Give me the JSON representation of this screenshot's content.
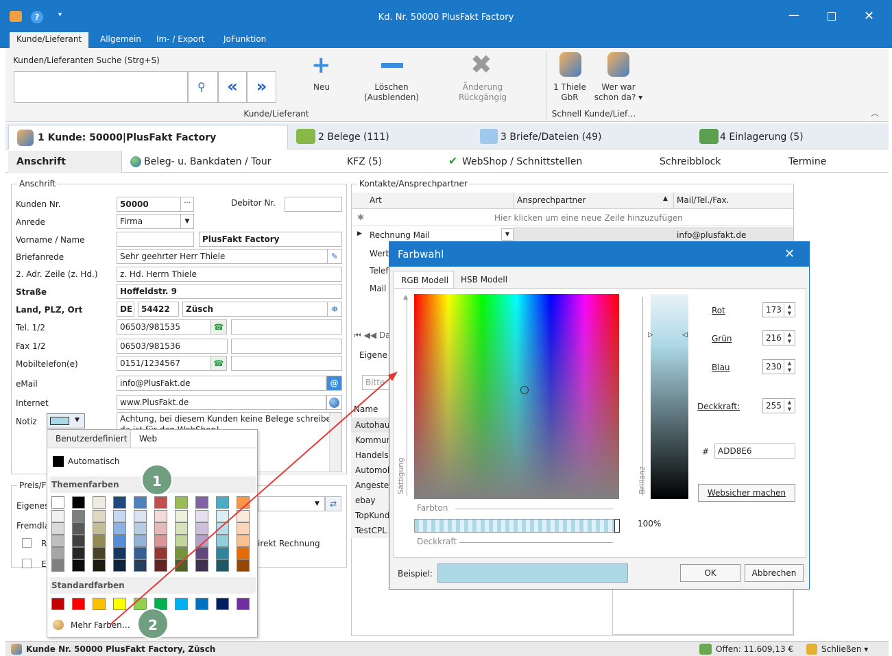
{
  "window": {
    "title": "Kd. Nr. 50000 PlusFakt Factory"
  },
  "menu": {
    "items": [
      "Kunde/Lieferant",
      "Allgemein",
      "Im- / Export",
      "JoFunktion"
    ]
  },
  "ribbon": {
    "search_label": "Kunden/Lieferanten Suche (Strg+S)",
    "search_value": "",
    "neu": "Neu",
    "loeschen_1": "Löschen",
    "loeschen_2": "(Ausblenden)",
    "rueck": "Änderung Rückgängig",
    "thiele_1": "1 Thiele",
    "thiele_2": "GbR",
    "werwar_1": "Wer war",
    "werwar_2": "schon da? ▾",
    "group1": "Kunde/Lieferant",
    "group2": "Schnell Kunde/Lief…"
  },
  "tabs_main": [
    "1 Kunde: 50000|PlusFakt Factory",
    "2 Belege (111)",
    "3 Briefe/Dateien (49)",
    "4 Einlagerung (5)"
  ],
  "tabs_sub": [
    "Anschrift",
    "Beleg- u. Bankdaten / Tour",
    "KFZ (5)",
    "WebShop / Schnittstellen",
    "Schreibblock",
    "Termine"
  ],
  "anschrift": {
    "group": "Anschrift",
    "kunden_nr_label": "Kunden Nr.",
    "kunden_nr": "50000",
    "debitor_label": "Debitor Nr.",
    "debitor": "",
    "anrede_label": "Anrede",
    "anrede": "Firma",
    "name_label": "Vorname / Name",
    "vorname": "",
    "name": "PlusFakt Factory",
    "briefanrede_label": "Briefanrede",
    "briefanrede": "Sehr geehrter Herr Thiele",
    "adr2_label": "2. Adr. Zeile (z. Hd.)",
    "adr2": "z. Hd. Herrn Thiele",
    "strasse_label": "Straße",
    "strasse": "Hoffeldstr. 9",
    "land_label": "Land, PLZ, Ort",
    "land": "DE",
    "plz": "54422",
    "ort": "Züsch",
    "tel_label": "Tel. 1/2",
    "tel1": "06503/981535",
    "tel2": "",
    "fax_label": "Fax 1/2",
    "fax1": "06503/981536",
    "fax2": "",
    "mobil_label": "Mobiltelefon(e)",
    "mobil1": "0151/1234567",
    "mobil2": "",
    "email_label": "eMail",
    "email": "info@PlusFakt.de",
    "internet_label": "Internet",
    "internet": "www.PlusFakt.de",
    "notiz_label": "Notiz",
    "notiz": "Achtung, bei diesem Kunden keine Belege schreiben,",
    "notiz_2": "da ist für den WebShop!"
  },
  "preis": {
    "group": "Preis/F",
    "eigenes": "Eigenes",
    "fremd": "Fremdla",
    "r": "R",
    "e": "E",
    "direkt": "irekt Rechnung"
  },
  "kontakte": {
    "group": "Kontakte/Ansprechpartner",
    "col_art": "Art",
    "col_ansprech": "Ansprechpartner",
    "col_mail": "Mail/Tel./Fax.",
    "new_row": "Hier klicken um eine neue Zeile hinzuzufügen",
    "rows": [
      {
        "art": "Rechnung Mail",
        "ansprech": "",
        "mail": "info@plusfakt.de"
      },
      {
        "art": "Werb",
        "ansprech": "",
        "mail": ""
      },
      {
        "art": "Telef",
        "ansprech": "",
        "mail": ""
      },
      {
        "art": "Mail",
        "ansprech": "",
        "mail": ""
      }
    ],
    "nav": "⏮ ◀◀ Da",
    "eigene": "Eigene I",
    "bitte": "Bitte",
    "name_col": "Name",
    "names": [
      "Autohaus",
      "Kommuni",
      "Handelsk",
      "Automob",
      "Angestel",
      "ebay",
      "TopKund",
      "TestCPL"
    ]
  },
  "popup": {
    "tab1": "Benutzerdefiniert",
    "tab2": "Web",
    "auto": "Automatisch",
    "themen": "Themenfarben",
    "standard": "Standardfarben",
    "mehr": "Mehr Farben…"
  },
  "themecolors": [
    [
      "#ffffff",
      "#f2f2f2",
      "#d9d9d9",
      "#bfbfbf",
      "#a6a6a6",
      "#808080"
    ],
    [
      "#000000",
      "#7f7f7f",
      "#595959",
      "#404040",
      "#262626",
      "#0d0d0d"
    ],
    [
      "#eeece1",
      "#ddd9c3",
      "#c4bd97",
      "#938953",
      "#494429",
      "#1d1b10"
    ],
    [
      "#1f497d",
      "#c6d9f0",
      "#8db3e2",
      "#548dd4",
      "#17365d",
      "#0f243e"
    ],
    [
      "#4f81bd",
      "#dbe5f1",
      "#b8cce4",
      "#95b3d7",
      "#366092",
      "#244061"
    ],
    [
      "#c0504d",
      "#f2dcdb",
      "#e5b9b7",
      "#d99694",
      "#953734",
      "#632423"
    ],
    [
      "#9bbb59",
      "#ebf1dd",
      "#d7e3bc",
      "#c3d69b",
      "#76923c",
      "#4f6128"
    ],
    [
      "#8064a2",
      "#e5e0ec",
      "#ccc1d9",
      "#b2a2c7",
      "#5f497a",
      "#3f3151"
    ],
    [
      "#4bacc6",
      "#dbeef3",
      "#b7dde8",
      "#92cddc",
      "#31859b",
      "#205867"
    ],
    [
      "#f79646",
      "#fdeada",
      "#fbd5b5",
      "#fac08f",
      "#e36c09",
      "#974806"
    ]
  ],
  "stdcolors": [
    "#c00000",
    "#ff0000",
    "#ffc000",
    "#ffff00",
    "#92d050",
    "#00b050",
    "#00b0f0",
    "#0070c0",
    "#002060",
    "#7030a0"
  ],
  "badges": [
    "1",
    "2"
  ],
  "dialog": {
    "title": "Farbwahl",
    "tab_rgb": "RGB Modell",
    "tab_hsb": "HSB Modell",
    "saettigung": "Sättigung",
    "farbton": "Farbton",
    "deckkraft_axis": "Deckkraft",
    "brillanz": "Brillanz",
    "percent": "100%",
    "rot_label": "Rot",
    "rot": "173",
    "gruen_label": "Grün",
    "gruen": "216",
    "blau_label": "Blau",
    "blau": "230",
    "deck_label": "Deckkraft:",
    "deck": "255",
    "hash": "#",
    "hex": "ADD8E6",
    "websicher": "Websicher machen",
    "beispiel": "Beispiel:",
    "ok": "OK",
    "abbrechen": "Abbrechen",
    "color": "#add8e6"
  },
  "status": {
    "left": "Kunde Nr. 50000 PlusFakt Factory, Züsch",
    "offen": "Offen: 11.609,13 €",
    "schliessen": "Schließen ▾"
  }
}
